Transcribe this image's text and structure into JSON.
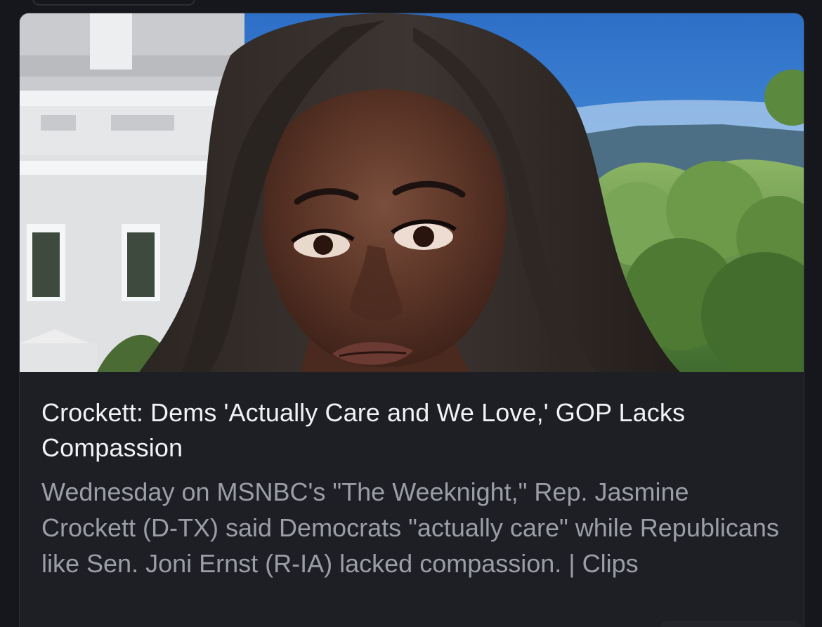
{
  "article": {
    "headline": "Crockett: Dems 'Actually Care and We Love,' GOP Lacks Compassion",
    "summary": "Wednesday on MSNBC's \"The Weeknight,\" Rep. Jasmine Crockett (D-TX) said Democrats \"actually care\" while Republicans like Sen. Joni Ernst (R-IA) lacked compassion.",
    "separator": " | ",
    "category": "Clips"
  },
  "colors": {
    "page_background": "#16171c",
    "card_background": "#1d1f24",
    "headline_text": "#f2f2f4",
    "summary_text": "#9c9ea6"
  },
  "icons": []
}
